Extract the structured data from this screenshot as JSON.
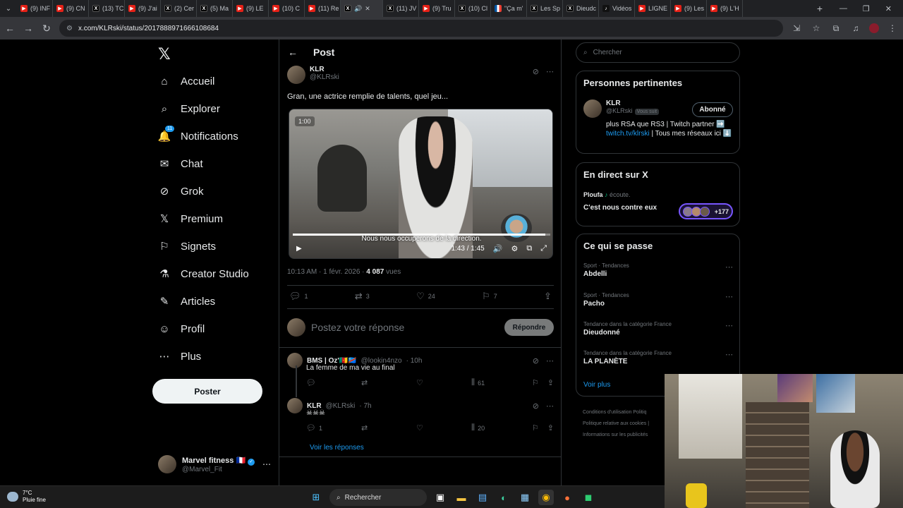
{
  "browser": {
    "tabs": [
      {
        "label": "(9) INF",
        "fav": "yt"
      },
      {
        "label": "(9) CN",
        "fav": "yt"
      },
      {
        "label": "(13) TC",
        "fav": "x"
      },
      {
        "label": "(9) J'ai",
        "fav": "yt"
      },
      {
        "label": "(2) Cer",
        "fav": "x"
      },
      {
        "label": "(5) Ma",
        "fav": "x"
      },
      {
        "label": "(9) LE",
        "fav": "yt"
      },
      {
        "label": "(10) C",
        "fav": "yt"
      },
      {
        "label": "(11) Re",
        "fav": "yt"
      },
      {
        "label": "",
        "fav": "x",
        "active": true
      },
      {
        "label": "(11) JV",
        "fav": "x"
      },
      {
        "label": "(9) Tru",
        "fav": "yt"
      },
      {
        "label": "(10) Cl",
        "fav": "x"
      },
      {
        "label": "\"Ça m'",
        "fav": "fr"
      },
      {
        "label": "Les Sp",
        "fav": "x"
      },
      {
        "label": "Dieudc",
        "fav": "x"
      },
      {
        "label": "Vidéos",
        "fav": "tt"
      },
      {
        "label": "LIGNE",
        "fav": "yt"
      },
      {
        "label": "(9) Les",
        "fav": "yt"
      },
      {
        "label": "(9) L'H",
        "fav": "yt"
      }
    ],
    "url": "x.com/KLRski/status/2017888971666108684"
  },
  "nav": {
    "items": [
      {
        "label": "Accueil",
        "icon": "⌂",
        "name": "home"
      },
      {
        "label": "Explorer",
        "icon": "⌕",
        "name": "explore"
      },
      {
        "label": "Notifications",
        "icon": "🔔",
        "name": "notifications",
        "badge": "11"
      },
      {
        "label": "Chat",
        "icon": "✉",
        "name": "chat"
      },
      {
        "label": "Grok",
        "icon": "⊘",
        "name": "grok"
      },
      {
        "label": "Premium",
        "icon": "𝕏",
        "name": "premium"
      },
      {
        "label": "Signets",
        "icon": "⚐",
        "name": "bookmarks"
      },
      {
        "label": "Creator Studio",
        "icon": "⚗",
        "name": "creator-studio"
      },
      {
        "label": "Articles",
        "icon": "✎",
        "name": "articles"
      },
      {
        "label": "Profil",
        "icon": "☺",
        "name": "profile"
      },
      {
        "label": "Plus",
        "icon": "⋯",
        "name": "more"
      }
    ],
    "post_button": "Poster",
    "account": {
      "name": "Marvel fitness",
      "flag": "🇫🇷",
      "handle": "@Marvel_Fit"
    }
  },
  "post": {
    "header": "Post",
    "author": {
      "name": "KLR",
      "handle": "@KLRski"
    },
    "text": "Gran, une actrice remplie de talents, quel jeu...",
    "video": {
      "badge": "1:00",
      "subtitle": "Nous nous occuperons de la direction.",
      "time": "1:43 / 1:45",
      "progress": 0.98
    },
    "meta": {
      "time": "10:13 AM · 1 févr. 2026 · ",
      "views": "4 087",
      "views_label": " vues"
    },
    "stats": {
      "replies": "1",
      "reposts": "3",
      "likes": "24",
      "bookmarks": "7"
    },
    "reply_placeholder": "Postez votre réponse",
    "reply_button": "Répondre"
  },
  "replies": [
    {
      "name": "BMS | Oz'🇨🇲🇨🇩",
      "handle": "@lookin4nzo",
      "time": "· 10h",
      "text": "La femme de ma vie au final",
      "replies": "",
      "views": "61"
    },
    {
      "name": "KLR",
      "handle": "@KLRski",
      "time": "· 7h",
      "text": "☠☠☠",
      "replies": "1",
      "views": "20"
    }
  ],
  "voir_reponses": "Voir les réponses",
  "right": {
    "search_placeholder": "Chercher",
    "pertinent": {
      "title": "Personnes pertinentes",
      "name": "KLR",
      "handle": "@KLRski",
      "follows_you": "Vous suit",
      "button": "Abonné",
      "bio_pre": "plus RSA que RS3 | Twitch partner ➡️ ",
      "bio_link": "twitch.tv/klrski",
      "bio_post": " | Tous mes réseaux ici ⬇️"
    },
    "live": {
      "title": "En direct sur X",
      "host": "Ploufa",
      "host_suffix": " écoute.",
      "space_title": "C'est nous contre eux",
      "count": "+177"
    },
    "trends": {
      "title": "Ce qui se passe",
      "items": [
        {
          "category": "Sport · Tendances",
          "topic": "Abdelli"
        },
        {
          "category": "Sport · Tendances",
          "topic": "Pacho"
        },
        {
          "category": "Tendance dans la catégorie France",
          "topic": "Dieudonné"
        },
        {
          "category": "Tendance dans la catégorie France",
          "topic": "LA PLANÈTE"
        }
      ],
      "more": "Voir plus"
    },
    "footer": [
      "Conditions d'utilisation   Politiq",
      "Politique relative aux cookies   |",
      "Informations sur les publicités"
    ]
  },
  "taskbar": {
    "temp": "7°C",
    "weather": "Pluie fine",
    "search": "Rechercher"
  }
}
